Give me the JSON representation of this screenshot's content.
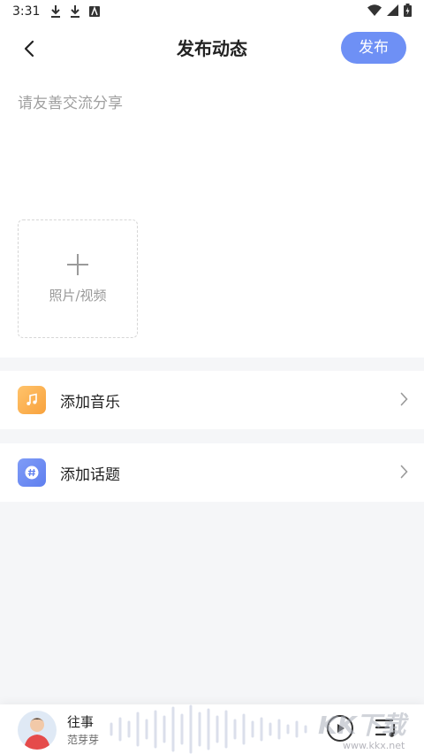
{
  "status_bar": {
    "time": "3:31"
  },
  "header": {
    "title": "发布动态",
    "publish_label": "发布"
  },
  "editor": {
    "placeholder": "请友善交流分享"
  },
  "upload": {
    "label": "照片/视频"
  },
  "options": {
    "music_label": "添加音乐",
    "topic_label": "添加话题"
  },
  "player": {
    "song_title": "往事",
    "artist": "范芽芽"
  },
  "watermark": {
    "logo": "KK下载",
    "url": "www.kkx.net"
  },
  "colors": {
    "accent": "#6e90f5",
    "music_icon": "#f8a23d",
    "topic_icon": "#5f7fef"
  }
}
